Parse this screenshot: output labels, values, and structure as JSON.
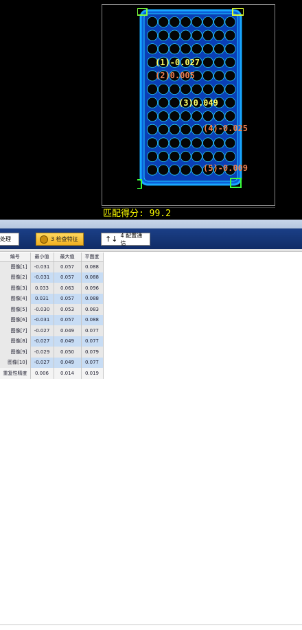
{
  "viewer": {
    "score_text": "匹配得分: 99.2",
    "annotations": [
      {
        "id": "1",
        "text": "(1)-0.027",
        "color": "yellow"
      },
      {
        "id": "2",
        "text": "(2)0.005",
        "color": "orange"
      },
      {
        "id": "3",
        "text": "(3)0.049",
        "color": "yellow"
      },
      {
        "id": "4",
        "text": "(4)-0.025",
        "color": "orange"
      },
      {
        "id": "5",
        "text": "(5)-0.009",
        "color": "orange"
      }
    ],
    "plate": {
      "columns": 8,
      "rows": 12
    }
  },
  "toolbar": {
    "process_label": "处理",
    "verify_label": "3 检查特征",
    "comm_label": "4 配置通信",
    "verify_icon": "coin-icon",
    "comm_icon": "up-down-arrows-icon"
  },
  "table": {
    "headers": [
      "编号",
      "最小值",
      "最大值",
      "平面度"
    ],
    "rows": [
      [
        "图像[1]",
        "-0.031",
        "0.057",
        "0.088"
      ],
      [
        "图像[2]",
        "-0.031",
        "0.057",
        "0.088"
      ],
      [
        "图像[3]",
        "0.033",
        "0.063",
        "0.096"
      ],
      [
        "图像[4]",
        "0.031",
        "0.057",
        "0.088"
      ],
      [
        "图像[5]",
        "-0.030",
        "0.053",
        "0.083"
      ],
      [
        "图像[6]",
        "-0.031",
        "0.057",
        "0.088"
      ],
      [
        "图像[7]",
        "-0.027",
        "0.049",
        "0.077"
      ],
      [
        "图像[8]",
        "-0.027",
        "0.049",
        "0.077"
      ],
      [
        "图像[9]",
        "-0.029",
        "0.050",
        "0.079"
      ],
      [
        "图像[10]",
        "-0.027",
        "0.049",
        "0.077"
      ],
      [
        "重复性精度",
        "0.006",
        "0.014",
        "0.019"
      ]
    ]
  }
}
